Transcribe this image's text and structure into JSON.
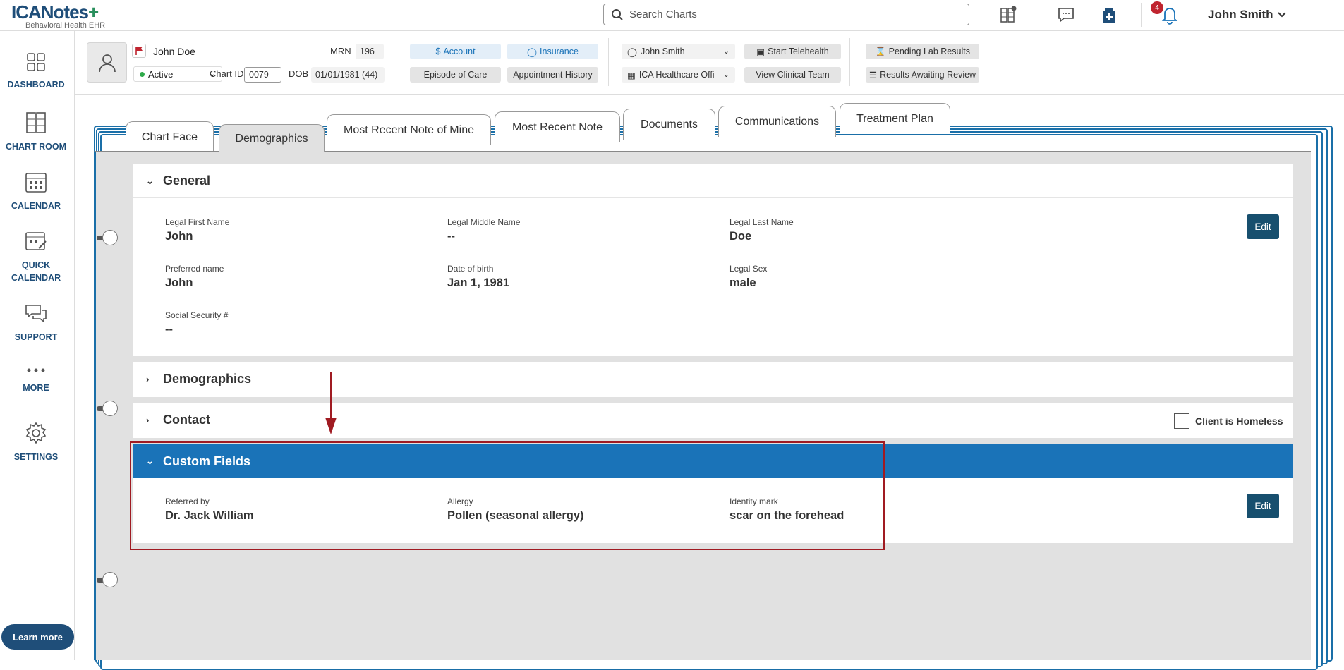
{
  "app": {
    "logo_text": "ICANotes",
    "logo_plus": "+",
    "logo_sub": "Behavioral Health EHR"
  },
  "search": {
    "placeholder": "Search Charts"
  },
  "notifications": {
    "count": "4"
  },
  "user": {
    "name": "John Smith"
  },
  "sidebar": {
    "items": [
      {
        "label": "DASHBOARD",
        "icon": "dashboard-icon"
      },
      {
        "label": "CHART ROOM",
        "icon": "chart-room-icon"
      },
      {
        "label": "CALENDAR",
        "icon": "calendar-icon"
      },
      {
        "label": "QUICK CALENDAR",
        "icon": "quick-calendar-icon"
      },
      {
        "label": "SUPPORT",
        "icon": "support-icon"
      },
      {
        "label": "MORE",
        "icon": "more-icon"
      },
      {
        "label": "SETTINGS",
        "icon": "gear-icon"
      }
    ],
    "learn_more": "Learn more"
  },
  "patient": {
    "name": "John Doe",
    "status": "Active",
    "mrn_label": "MRN",
    "mrn": "196",
    "chart_id_label": "Chart ID",
    "chart_id": "0079",
    "dob_label": "DOB",
    "dob": "01/01/1981 (44)",
    "buttons": {
      "account": "Account",
      "insurance": "Insurance",
      "episode": "Episode of Care",
      "appointments": "Appointment History",
      "telehealth": "Start Telehealth",
      "clinical_team": "View Clinical Team",
      "pending_labs": "Pending Lab Results",
      "results_review": "Results Awaiting Review"
    },
    "provider": "John Smith",
    "office": "ICA Healthcare Offi"
  },
  "tabs": [
    "Chart Face",
    "Demographics",
    "Most Recent Note of Mine",
    "Most Recent Note",
    "Documents",
    "Communications",
    "Treatment Plan"
  ],
  "sections": {
    "general": {
      "title": "General",
      "edit": "Edit",
      "fields": {
        "first_label": "Legal First Name",
        "first": "John",
        "middle_label": "Legal Middle Name",
        "middle": "--",
        "last_label": "Legal Last Name",
        "last": "Doe",
        "preferred_label": "Preferred name",
        "preferred": "John",
        "dob_label": "Date of birth",
        "dob": "Jan 1, 1981",
        "sex_label": "Legal Sex",
        "sex": "male",
        "ssn_label": "Social Security #",
        "ssn": "--"
      }
    },
    "demographics": {
      "title": "Demographics"
    },
    "contact": {
      "title": "Contact",
      "homeless_label": "Client is Homeless"
    },
    "custom": {
      "title": "Custom Fields",
      "edit": "Edit",
      "fields": {
        "referred_label": "Referred by",
        "referred": "Dr. Jack William",
        "allergy_label": "Allergy",
        "allergy": "Pollen (seasonal allergy)",
        "identity_label": "Identity mark",
        "identity": "scar on the forehead"
      }
    }
  },
  "colors": {
    "accent": "#1a73b8",
    "highlight": "#a01b22",
    "edit_btn": "#174f6e"
  }
}
